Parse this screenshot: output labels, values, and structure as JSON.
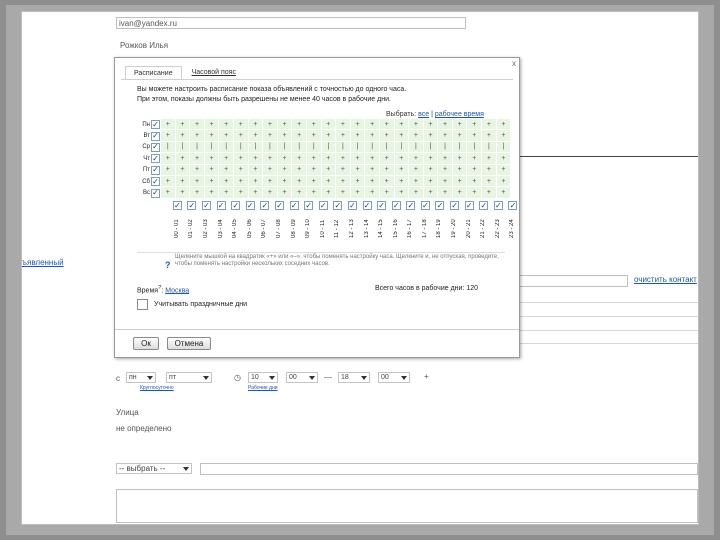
{
  "background": {
    "email_value": "ivan@yandex.ru",
    "name_value": "Рожков Илья",
    "left_link": "ъявленный",
    "right_link": "очистить контакт",
    "schedule": {
      "from_day": "пн",
      "to_day": "пт",
      "time_icon": "clock-icon",
      "from_hour": "10",
      "from_min": "00",
      "dash": "—",
      "to_hour": "18",
      "to_min": "00",
      "plus": "+",
      "small_link_1": "Круглосуточно",
      "small_link_2": "Рабочие дни"
    },
    "label_1": "Улица",
    "label_2": "не определено",
    "select_placeholder": "-- выбрать --"
  },
  "dialog": {
    "close_label": "x",
    "tabs": [
      "Расписание",
      "Часовой пояс"
    ],
    "description_line1": "Вы можете настроить расписание показа объявлений с точностью до одного часа.",
    "description_line2": "При этом, показы должны быть разрешены не менее 40 часов в рабочие дни.",
    "choose_prefix": "Выбрать:",
    "choose_all": "все",
    "choose_workhours": "рабочее время",
    "days": [
      "Пн",
      "Вт",
      "Ср",
      "Чт",
      "Пт",
      "Сб",
      "Вс"
    ],
    "cell_symbols": [
      "+",
      "+",
      "+",
      "+",
      "+",
      "+",
      "+",
      "|"
    ],
    "hours": [
      "00 - 01",
      "01 - 02",
      "02 - 03",
      "03 - 04",
      "04 - 05",
      "05 - 06",
      "06 - 07",
      "07 - 08",
      "08 - 09",
      "09 - 10",
      "10 - 11",
      "11 - 12",
      "12 - 13",
      "13 - 14",
      "14 - 15",
      "15 - 16",
      "16 - 17",
      "17 - 18",
      "18 - 19",
      "19 - 20",
      "20 - 21",
      "21 - 22",
      "22 - 23",
      "23 - 24"
    ],
    "checkbox_mark": "✓",
    "hint_icon": "?",
    "hint_text": "Щелкните мышкой на квадратик «+» или «–», чтобы поменять настройку часа. Щелкните и, не отпуская, проведите, чтобы поменять настройки нескольких соседних часов.",
    "timezone_label": "Время",
    "timezone_sup": "?",
    "timezone_value": "Москва",
    "total_hours": "Всего часов в рабочие дни: 120",
    "holiday_label": "Учитывать праздничные дни",
    "ok_label": "Ок",
    "cancel_label": "Отмена"
  }
}
